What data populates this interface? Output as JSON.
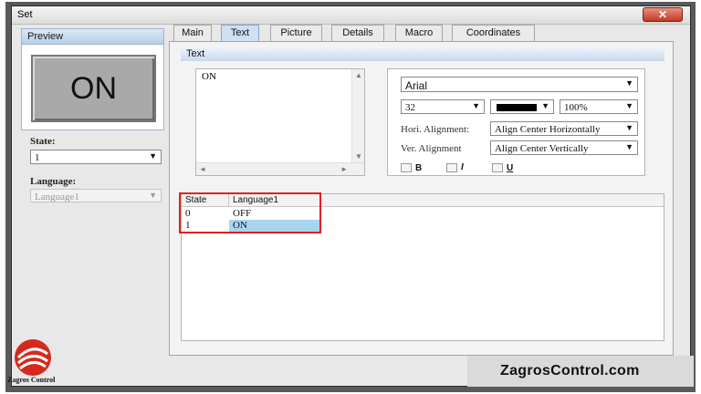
{
  "window": {
    "title": "Set",
    "close_glyph": "✕"
  },
  "preview": {
    "header": "Preview",
    "button_text": "ON"
  },
  "state": {
    "label": "State:",
    "value": "1"
  },
  "language": {
    "label": "Language:",
    "value": "Language1"
  },
  "tabs": [
    {
      "label": "Main",
      "active": false
    },
    {
      "label": "Text",
      "active": true
    },
    {
      "label": "Picture",
      "active": false
    },
    {
      "label": "Details",
      "active": false
    },
    {
      "label": "Macro",
      "active": false
    },
    {
      "label": "Coordinates",
      "active": false
    }
  ],
  "text_panel": {
    "header": "Text",
    "content": "ON",
    "font_name": "Arial",
    "font_size": "32",
    "font_color": "#000000",
    "scale": "100%",
    "hori_label": "Hori. Alignment:",
    "hori_value": "Align Center Horizontally",
    "vert_label": "Ver. Alignment",
    "vert_value": "Align Center Vertically",
    "bold_label": "B",
    "italic_label": "I",
    "underline_label": "U"
  },
  "text_table": {
    "columns": [
      "State",
      "Language1"
    ],
    "rows": [
      {
        "state": "0",
        "text": "OFF",
        "selected": false
      },
      {
        "state": "1",
        "text": "ON",
        "selected": true
      }
    ]
  },
  "brand": {
    "name": "ZagrosControl.com",
    "logo_text": "Zagros Control",
    "logo_color": "#d42a1e"
  },
  "icons": {
    "dropdown": "▼",
    "scroll_up": "▲",
    "scroll_down": "▼",
    "scroll_left": "◄",
    "scroll_right": "►"
  }
}
